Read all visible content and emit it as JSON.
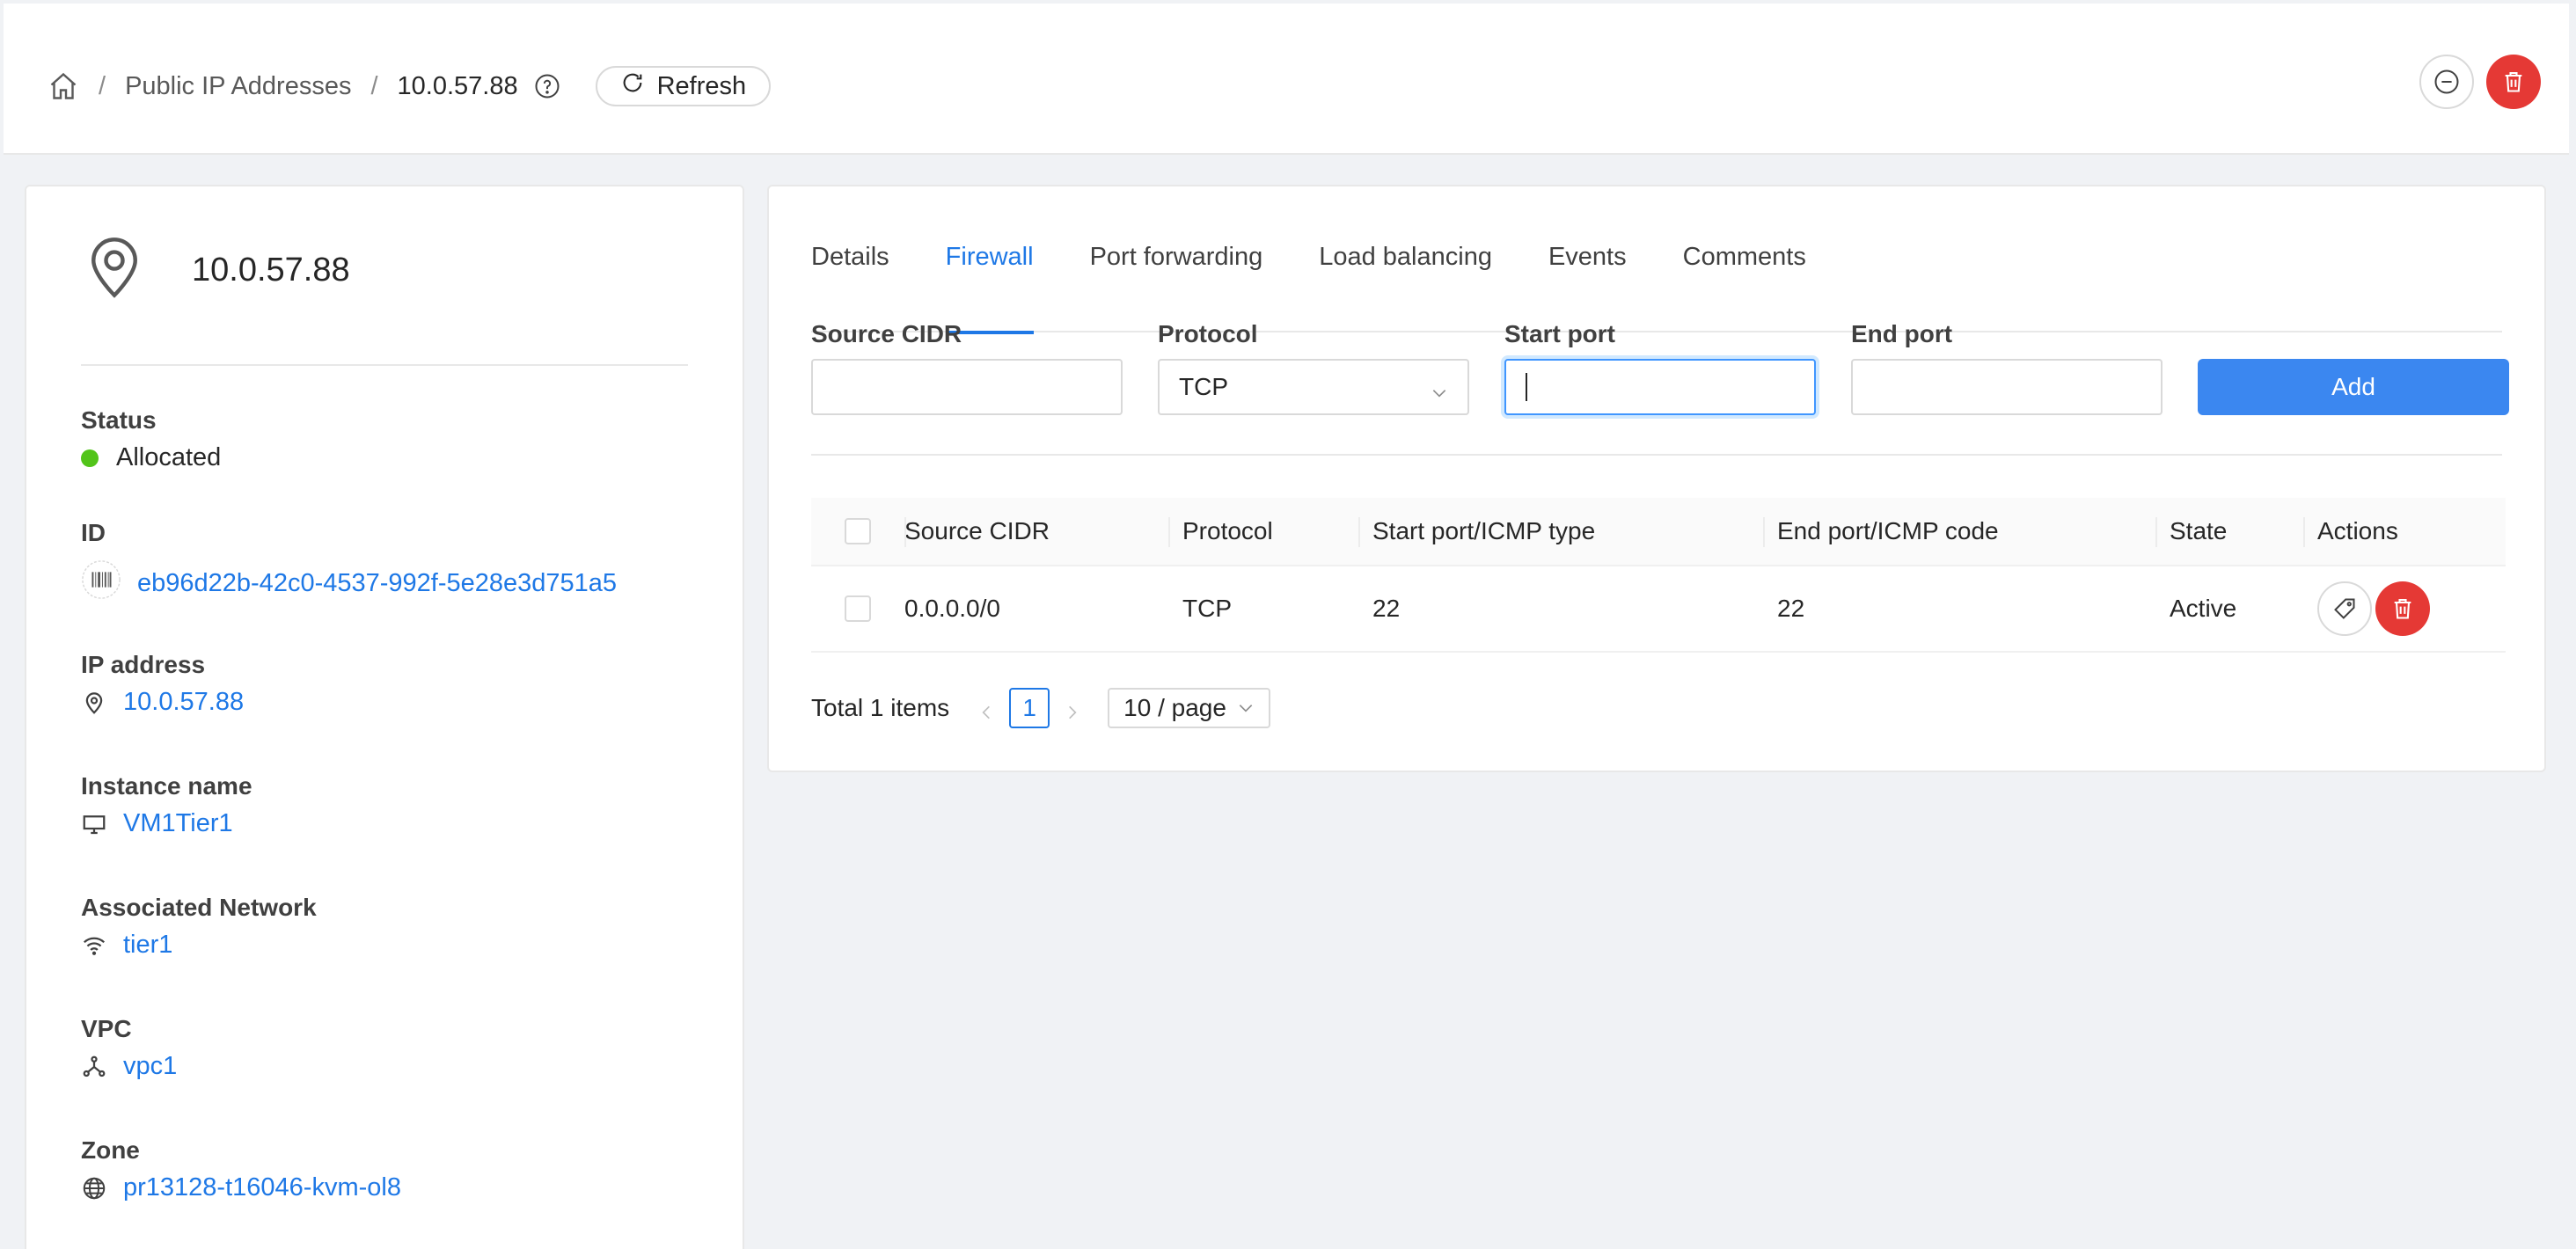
{
  "header": {
    "breadcrumb": {
      "home_icon": "home-icon",
      "section": "Public IP Addresses",
      "separator": "/",
      "current": "10.0.57.88"
    },
    "help_icon": "question-circle-icon",
    "refresh_label": "Refresh",
    "actions": [
      {
        "name": "release-ip-button",
        "icon": "minus-circle-icon"
      },
      {
        "name": "delete-button",
        "icon": "trash-icon"
      }
    ]
  },
  "resource": {
    "icon": "map-pin-icon",
    "title": "10.0.57.88",
    "fields": {
      "status": {
        "label": "Status",
        "value": "Allocated",
        "color": "#52c41a"
      },
      "id": {
        "label": "ID",
        "value": "eb96d22b-42c0-4537-992f-5e28e3d751a5",
        "icon": "barcode-icon"
      },
      "ip": {
        "label": "IP address",
        "value": "10.0.57.88",
        "icon": "map-pin-icon"
      },
      "instance": {
        "label": "Instance name",
        "value": "VM1Tier1",
        "icon": "desktop-icon"
      },
      "network": {
        "label": "Associated Network",
        "value": "tier1",
        "icon": "wifi-icon"
      },
      "vpc": {
        "label": "VPC",
        "value": "vpc1",
        "icon": "network-nodes-icon"
      },
      "zone": {
        "label": "Zone",
        "value": "pr13128-t16046-kvm-ol8",
        "icon": "globe-icon"
      }
    }
  },
  "tabs": [
    "Details",
    "Firewall",
    "Port forwarding",
    "Load balancing",
    "Events",
    "Comments"
  ],
  "active_tab": "Firewall",
  "form": {
    "source_cidr": {
      "label": "Source CIDR",
      "value": ""
    },
    "protocol": {
      "label": "Protocol",
      "value": "TCP"
    },
    "start_port": {
      "label": "Start port",
      "value": ""
    },
    "end_port": {
      "label": "End port",
      "value": ""
    },
    "add_label": "Add"
  },
  "table": {
    "columns": [
      "Source CIDR",
      "Protocol",
      "Start port/ICMP type",
      "End port/ICMP code",
      "State",
      "Actions"
    ],
    "rows": [
      {
        "cidr": "0.0.0.0/0",
        "protocol": "TCP",
        "start": "22",
        "end": "22",
        "state": "Active"
      }
    ]
  },
  "pagination": {
    "total": "Total 1 items",
    "page": "1",
    "page_size": "10 / page"
  },
  "colors": {
    "accent": "#1e78e6",
    "primary_button": "#3b87f0",
    "danger": "#e53935",
    "status_ok": "#52c41a"
  }
}
